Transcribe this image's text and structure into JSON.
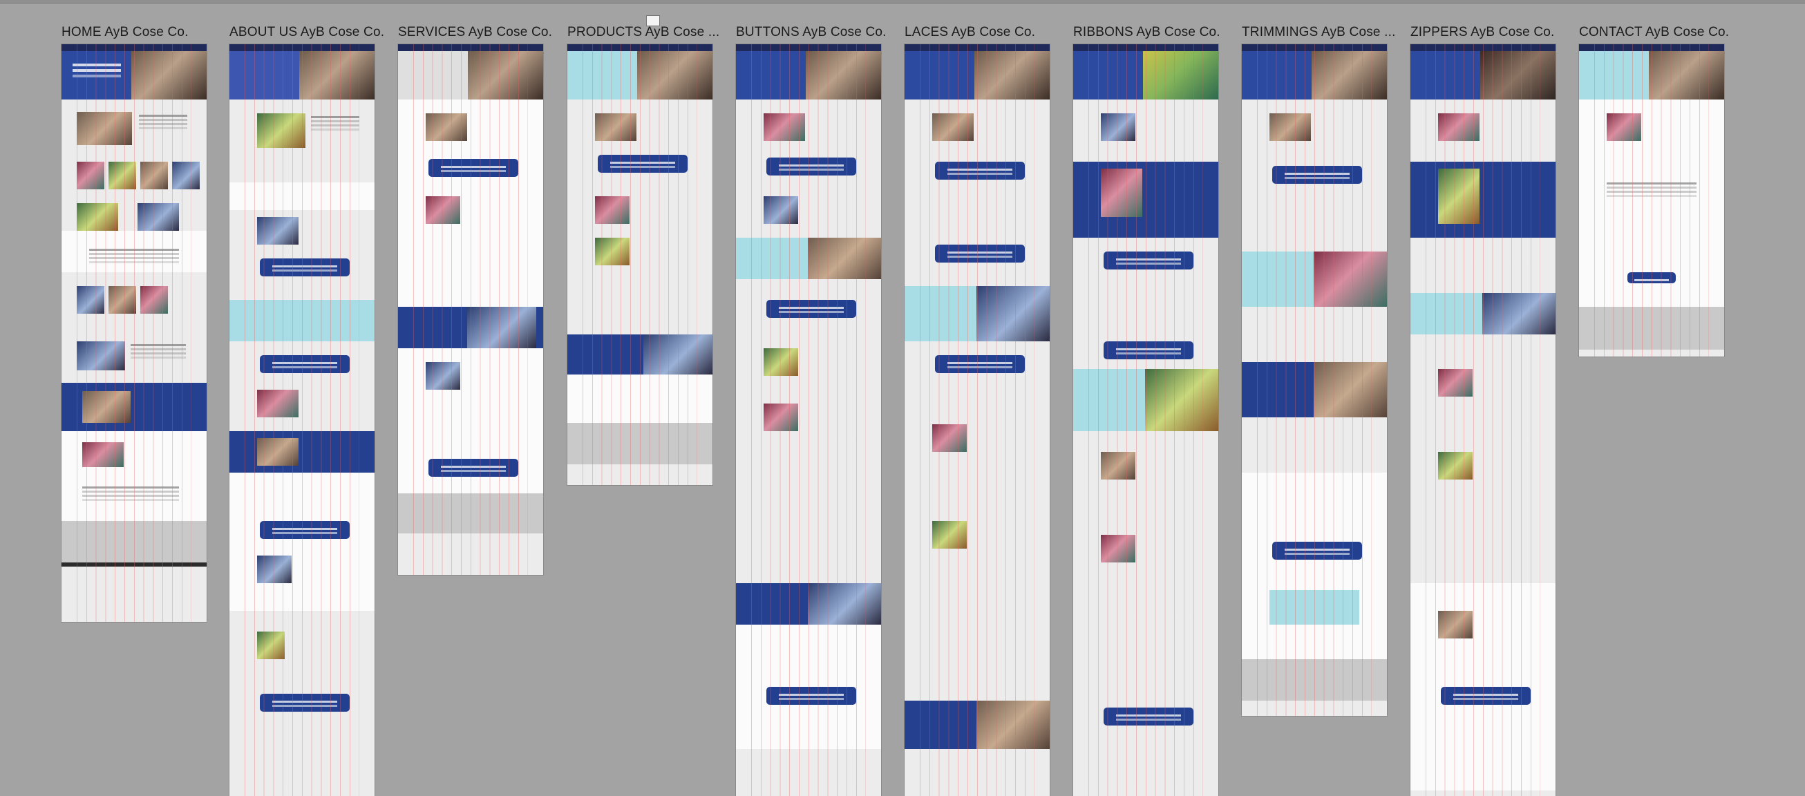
{
  "canvas": {
    "background": "#a3a3a3"
  },
  "frames": [
    {
      "id": "home",
      "title": "HOME  AyB Cose Co.",
      "length": 836
    },
    {
      "id": "about",
      "title": "ABOUT US  AyB Cose Co.",
      "length": 1088
    },
    {
      "id": "services",
      "title": "SERVICES AyB Cose Co.",
      "length": 768
    },
    {
      "id": "products",
      "title": "PRODUCTS AyB Cose ...",
      "length": 638
    },
    {
      "id": "buttons",
      "title": "BUTTONS AyB Cose Co.",
      "length": 1088
    },
    {
      "id": "laces",
      "title": "LACES AyB Cose Co.",
      "length": 1088
    },
    {
      "id": "ribbons",
      "title": "RIBBONS AyB Cose Co.",
      "length": 1088
    },
    {
      "id": "trimmings",
      "title": "TRIMMINGS AyB Cose ...",
      "length": 972
    },
    {
      "id": "zippers",
      "title": "ZIPPERS AyB Cose Co.",
      "length": 1088
    },
    {
      "id": "contact",
      "title": "CONTACT AyB Cose Co.",
      "length": 452
    }
  ],
  "theme": {
    "navy": "#24408f",
    "cyan": "#a9dde5",
    "light": "#ececec",
    "grid": "#ee5a5a"
  }
}
